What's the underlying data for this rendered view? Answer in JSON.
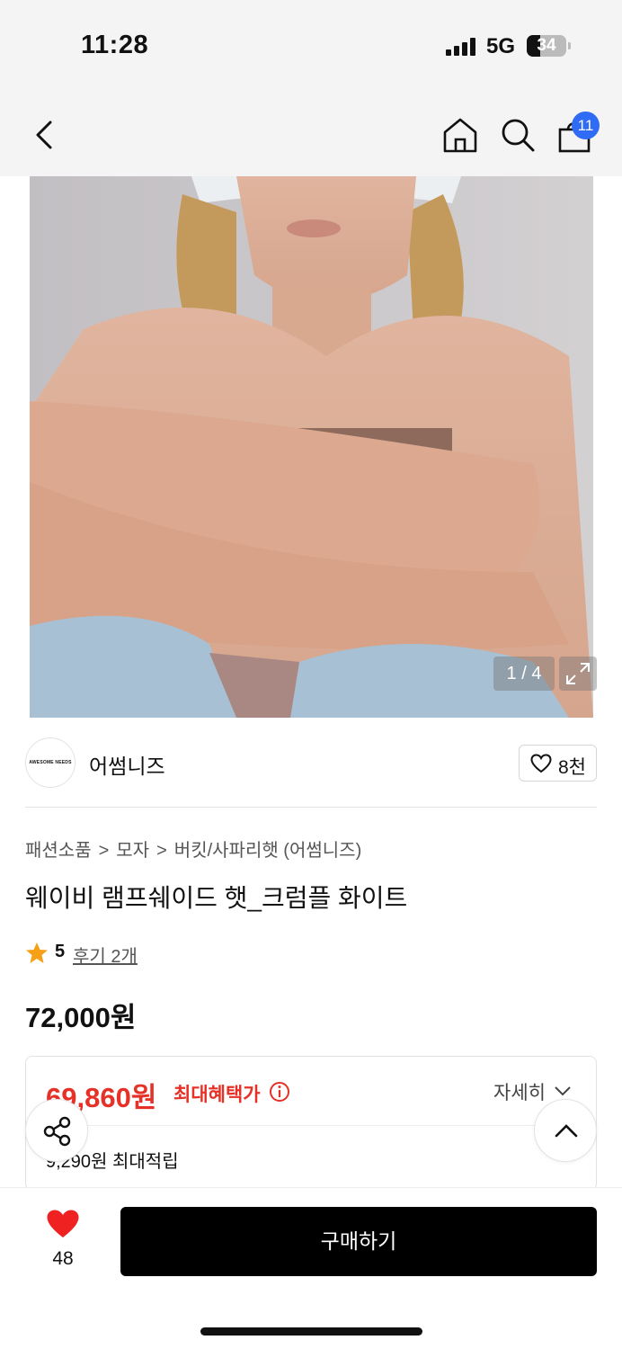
{
  "status": {
    "time": "11:28",
    "network": "5G",
    "battery": "34",
    "battery_level": 34
  },
  "nav": {
    "cart_count": "11"
  },
  "gallery": {
    "counter": "1 / 4"
  },
  "brand": {
    "name": "어썸니즈",
    "logo_text": "AWESOME NEEDS",
    "like_count": "8천"
  },
  "product": {
    "breadcrumb": [
      "패션소품",
      "모자",
      "버킷/사파리햇 (어썸니즈)"
    ],
    "title": "웨이비 램프쉐이드 햇_크럼플 화이트",
    "rating": "5",
    "review_link": "후기 2개",
    "price": "72,000원"
  },
  "benefit": {
    "price": "69,860원",
    "label": "최대혜택가",
    "detail_toggle": "자세히",
    "points": "9,290원 최대적립"
  },
  "bottom": {
    "wish_count": "48",
    "buy_label": "구매하기"
  },
  "colors": {
    "accent_red": "#e53127",
    "badge_blue": "#2f6bf5",
    "buy_button": "#000000"
  }
}
